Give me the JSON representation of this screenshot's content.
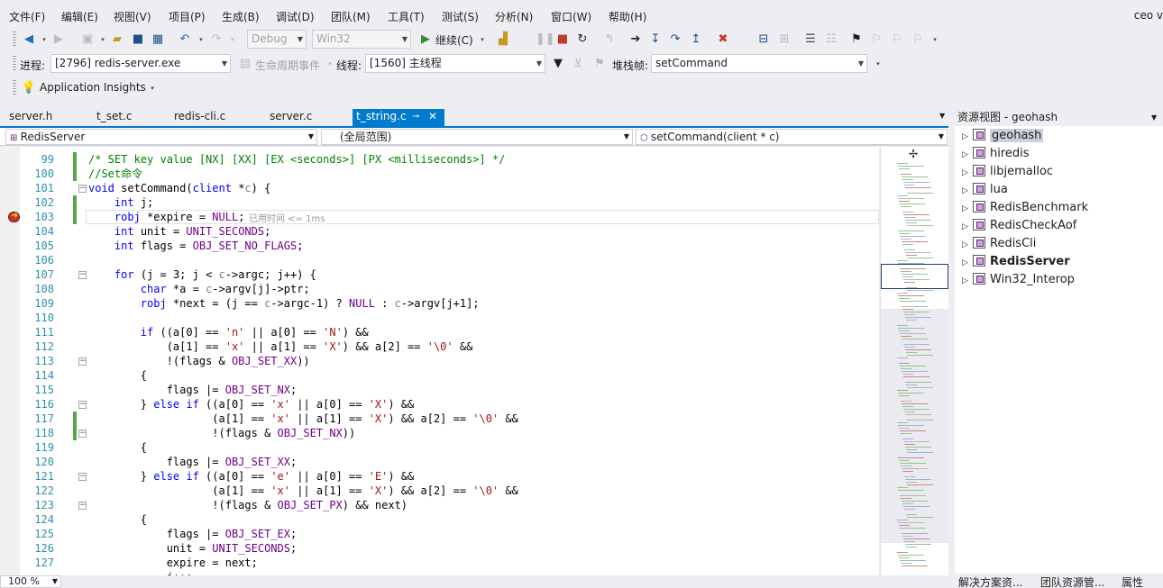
{
  "menu": [
    "文件(F)",
    "编辑(E)",
    "视图(V)",
    "项目(P)",
    "生成(B)",
    "调试(D)",
    "团队(M)",
    "工具(T)",
    "测试(S)",
    "分析(N)",
    "窗口(W)",
    "帮助(H)"
  ],
  "user": "ceo v",
  "toolbar1": {
    "config": "Debug",
    "platform": "Win32",
    "continue_label": "继续(C)"
  },
  "toolbar2": {
    "process_label": "进程:",
    "process": "[2796] redis-server.exe",
    "lifecycle": "生命周期事件",
    "thread_label": "线程:",
    "thread": "[1560] 主线程",
    "stack_label": "堆栈帧:",
    "stack": "setCommand"
  },
  "toolbar3": {
    "insights": "Application Insights"
  },
  "tabs": [
    {
      "label": "server.h"
    },
    {
      "label": "t_set.c"
    },
    {
      "label": "redis-cli.c"
    },
    {
      "label": "server.c"
    },
    {
      "label": "t_string.c",
      "active": true
    }
  ],
  "navbar": {
    "project": "RedisServer",
    "scope": "(全局范围)",
    "member": "setCommand(client * c)"
  },
  "editor": {
    "lines": [
      "99",
      "100",
      "101",
      "102",
      "103",
      "104",
      "105",
      "106",
      "107",
      "108",
      "109",
      "110",
      "111",
      "112",
      "113",
      "114",
      "115",
      "116",
      "117",
      "118",
      "119",
      "120",
      "121",
      "122",
      "123",
      "124",
      "125",
      "126",
      "127"
    ],
    "perf_tip": "已用时间 <= 1ms"
  },
  "zoom": "100 %",
  "solution": {
    "title": "资源视图 - geohash",
    "items": [
      {
        "label": "geohash",
        "selected": true
      },
      {
        "label": "hiredis"
      },
      {
        "label": "libjemalloc"
      },
      {
        "label": "lua"
      },
      {
        "label": "RedisBenchmark"
      },
      {
        "label": "RedisCheckAof"
      },
      {
        "label": "RedisCli"
      },
      {
        "label": "RedisServer",
        "bold": true
      },
      {
        "label": "Win32_Interop"
      }
    ],
    "bottom_tabs": [
      "解决方案资...",
      "团队资源管...",
      "属性"
    ]
  }
}
